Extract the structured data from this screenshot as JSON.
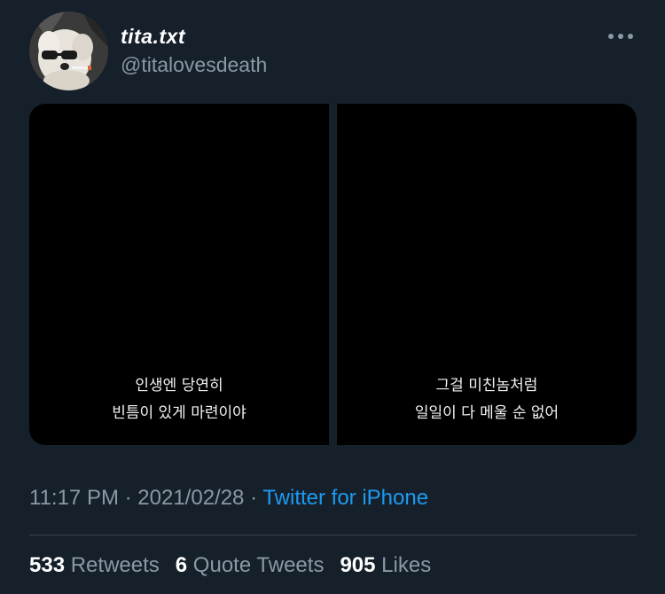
{
  "author": {
    "display_name": "tita.txt",
    "handle": "@titalovesdeath",
    "avatar_icon": "dog-with-sunglasses-avatar"
  },
  "more_icon": "more-dots-icon",
  "media": [
    {
      "caption_line1": "인생엔 당연히",
      "caption_line2": "빈틈이 있게 마련이야"
    },
    {
      "caption_line1": "그걸 미친놈처럼",
      "caption_line2": "일일이 다 메울 순 없어"
    }
  ],
  "meta": {
    "time": "11:17 PM",
    "separator1": " · ",
    "date": "2021/02/28",
    "separator2": " · ",
    "source": "Twitter for iPhone"
  },
  "stats": {
    "retweets_count": "533",
    "retweets_label": "Retweets",
    "quotes_count": "6",
    "quotes_label": "Quote Tweets",
    "likes_count": "905",
    "likes_label": "Likes"
  },
  "colors": {
    "background": "#15202b",
    "secondary_text": "#8b98a5",
    "link": "#1d9bf0",
    "divider": "#38444d"
  }
}
